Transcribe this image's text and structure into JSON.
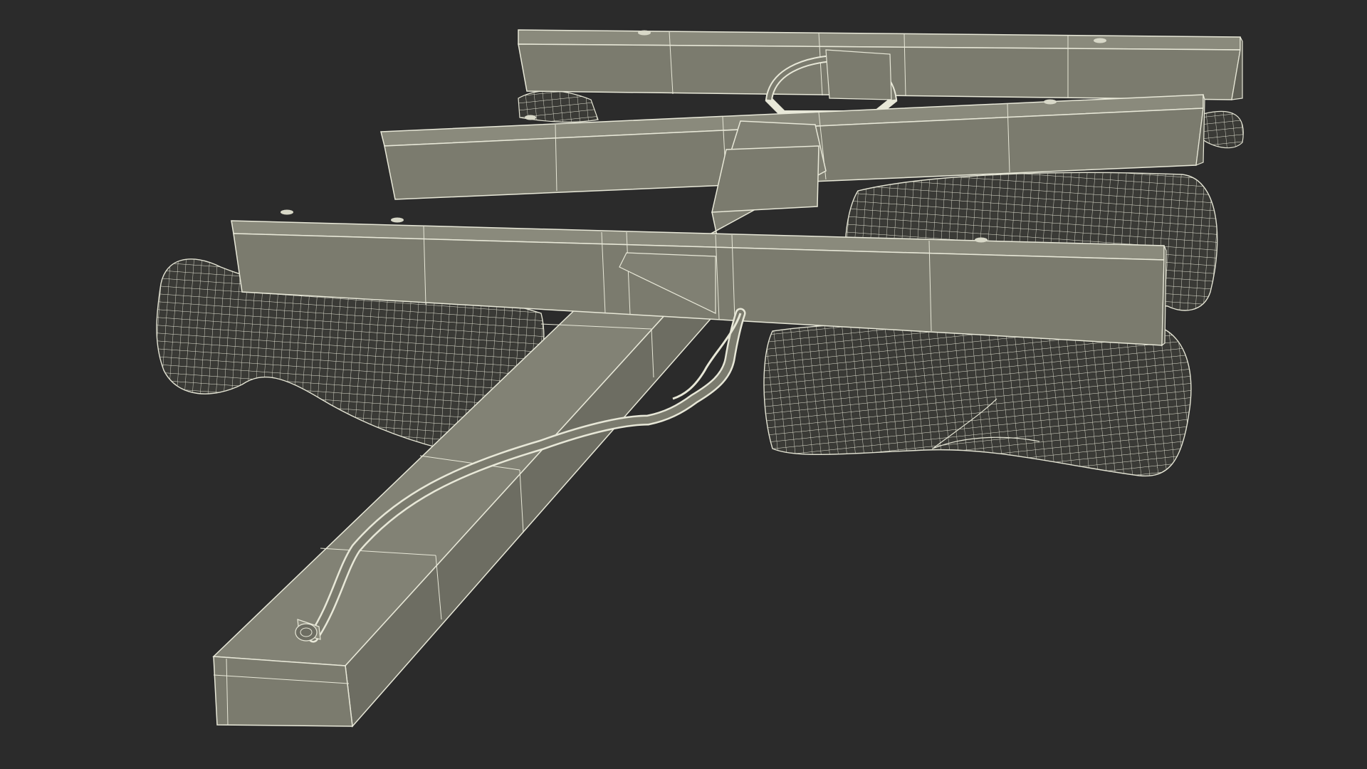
{
  "viewport": {
    "background_color": "#2b2b2b",
    "render_mode": "wireframe-on-shaded"
  },
  "model": {
    "surface_color": "#7b7b6e",
    "surface_light_color": "#8a8a7c",
    "surface_dark_color": "#5f5f55",
    "wire_color": "#e8e8d8",
    "bag_fill_color": "#3a3a36",
    "parts": [
      "drawbar",
      "front-crossbar",
      "middle-crossbar",
      "rear-crossbar",
      "center-clamp",
      "hydraulic-hose",
      "hose-fitting",
      "left-flotation-bag",
      "right-front-flotation-bag",
      "right-rear-flotation-bag",
      "rear-left-flotation-bag",
      "rear-right-flotation-bag"
    ]
  }
}
